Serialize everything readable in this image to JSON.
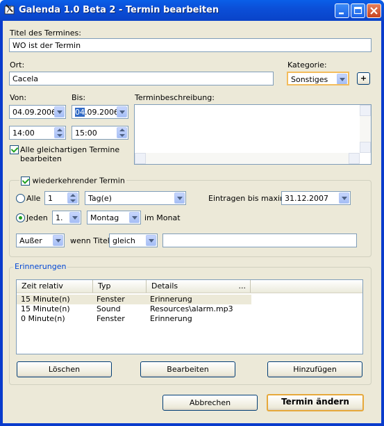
{
  "window": {
    "title": "Galenda 1.0 Beta 2 - Termin bearbeiten"
  },
  "form": {
    "title_label": "Titel des Termines:",
    "title_value": "WO ist der Termin",
    "location_label": "Ort:",
    "location_value": "Cacela",
    "category_label": "Kategorie:",
    "category_value": "Sonstiges",
    "category_add": "+",
    "from_label": "Von:",
    "to_label": "Bis:",
    "from_date": "04.09.2006",
    "to_date_sel": "04",
    "to_date_rest": ".09.2006",
    "from_time": "14:00",
    "to_time": "15:00",
    "description_label": "Terminbeschreibung:",
    "all_similar_line1": "Alle gleichartigen Termine",
    "all_similar_line2": "bearbeiten"
  },
  "recurrence": {
    "group_label": "wiederkehrender Termin",
    "all_label": "Alle",
    "interval": "1",
    "unit": "Tag(e)",
    "until_label": "Eintragen bis maximal:",
    "until_date": "31.12.2007",
    "each_label": "Jeden",
    "ordinal": "1.",
    "weekday": "Montag",
    "in_month": "im Monat",
    "except": "Außer",
    "when_title": "wenn Titel",
    "match": "gleich",
    "match_text": ""
  },
  "reminders": {
    "group_label": "Erinnerungen",
    "columns": [
      "Zeit relativ",
      "Typ",
      "Details",
      "..."
    ],
    "rows": [
      [
        "15 Minute(n)",
        "Fenster",
        "Erinnerung"
      ],
      [
        "15 Minute(n)",
        "Sound",
        "Resources\\alarm.mp3"
      ],
      [
        "0 Minute(n)",
        "Fenster",
        "Erinnerung"
      ]
    ],
    "delete_label": "Löschen",
    "edit_label": "Bearbeiten",
    "add_label": "Hinzufügen"
  },
  "footer": {
    "cancel_label": "Abbrechen",
    "submit_label": "Termin ändern"
  }
}
